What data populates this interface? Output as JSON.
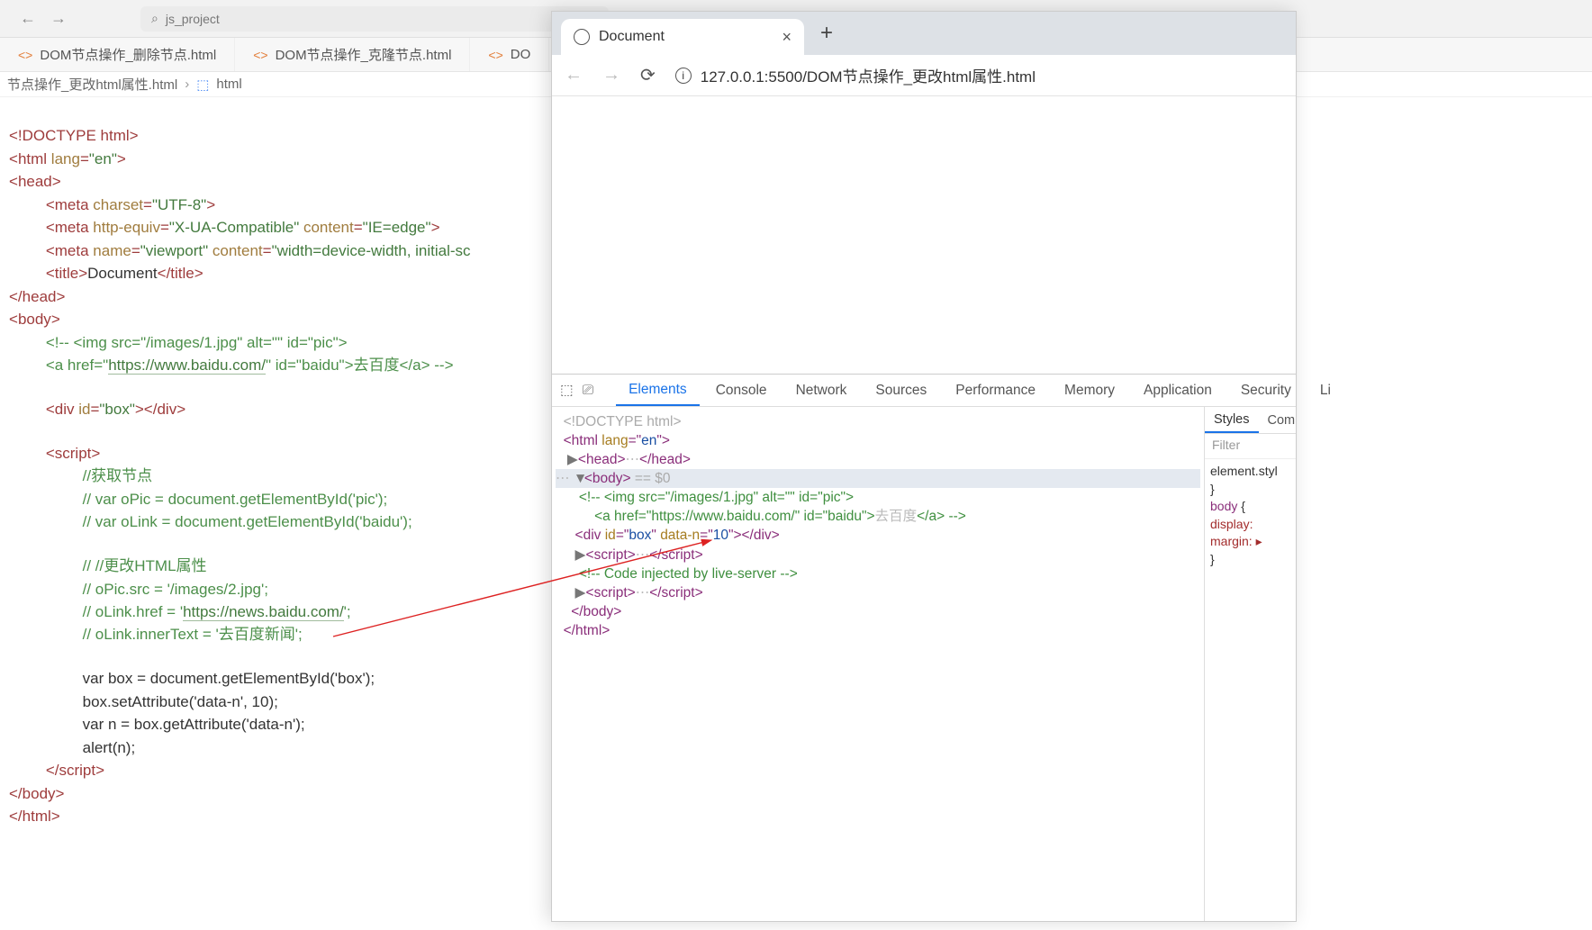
{
  "ide": {
    "search_placeholder": "js_project",
    "tabs": [
      {
        "label": "DOM节点操作_删除节点.html"
      },
      {
        "label": "DOM节点操作_克隆节点.html"
      },
      {
        "label": "DO"
      }
    ],
    "breadcrumb": {
      "file": "节点操作_更改html属性.html",
      "node": "html"
    }
  },
  "code": {
    "l1": "<!DOCTYPE html>",
    "l2a": "html",
    "l2b": "lang",
    "l2c": "\"en\"",
    "l3": "head",
    "l4a": "meta",
    "l4b": "charset",
    "l4c": "\"UTF-8\"",
    "l5a": "meta",
    "l5b": "http-equiv",
    "l5c": "\"X-UA-Compatible\"",
    "l5d": "content",
    "l5e": "\"IE=edge\"",
    "l6a": "meta",
    "l6b": "name",
    "l6c": "\"viewport\"",
    "l6d": "content",
    "l6e": "\"width=device-width, initial-sc",
    "l7a": "title",
    "l7b": "Document",
    "l8": "head",
    "l9": "body",
    "c1": "<!-- <img src=\"/images/1.jpg\" alt=\"\" id=\"pic\">",
    "c2a": "<a href=\"",
    "c2url": "https://www.baidu.com/",
    "c2b": "\" id=\"baidu\">去百度</a> -->",
    "l10a": "div",
    "l10b": "id",
    "l10c": "\"box\"",
    "l11": "script",
    "c3": "//获取节点",
    "c4": "// var oPic = document.getElementById('pic');",
    "c5": "// var oLink = document.getElementById('baidu');",
    "c6": "// //更改HTML属性",
    "c7": "// oPic.src = '/images/2.jpg';",
    "c8a": "// oLink.href = '",
    "c8url": "https://news.baidu.com/",
    "c8b": "';",
    "c9": "// oLink.innerText = '去百度新闻';",
    "j1": "var box = document.getElementById('box');",
    "j2": "box.setAttribute('data-n', 10);",
    "j3": "var n = box.getAttribute('data-n');",
    "j4": "alert(n);"
  },
  "browser": {
    "tab_title": "Document",
    "url": "127.0.0.1:5500/DOM节点操作_更改html属性.html"
  },
  "devtools": {
    "tabs": [
      "Elements",
      "Console",
      "Network",
      "Sources",
      "Performance",
      "Memory",
      "Application",
      "Security",
      "Li"
    ],
    "styles_tabs": [
      "Styles",
      "Com"
    ],
    "filter_placeholder": "Filter",
    "dom": {
      "doctype": "<!DOCTYPE html>",
      "html_open": "<html lang=\"en\">",
      "head": "<head>…</head>",
      "body_open": "<body>",
      "body_sel": " == $0",
      "cmt1": "<!-- <img src=\"/images/1.jpg\" alt=\"\" id=\"pic\">",
      "cmt2": "<a href=\"https://www.baidu.com/\" id=\"baidu\">去百度</a> -->",
      "div": "<div id=\"box\" data-n=\"10\"></div>",
      "script1": "<script>…</scr",
      "script1b": "ipt>",
      "cmt3": "<!-- Code injected by live-server -->",
      "script2": "<script>…</scr",
      "script2b": "ipt>",
      "body_close": "</body>",
      "html_close": "</html>"
    },
    "styles_body": {
      "l1": "element.styl",
      "l2": "}",
      "l3a": "body",
      "l3b": " {",
      "l4": "display:",
      "l5": "margin: ▸",
      "l6": "}"
    }
  }
}
